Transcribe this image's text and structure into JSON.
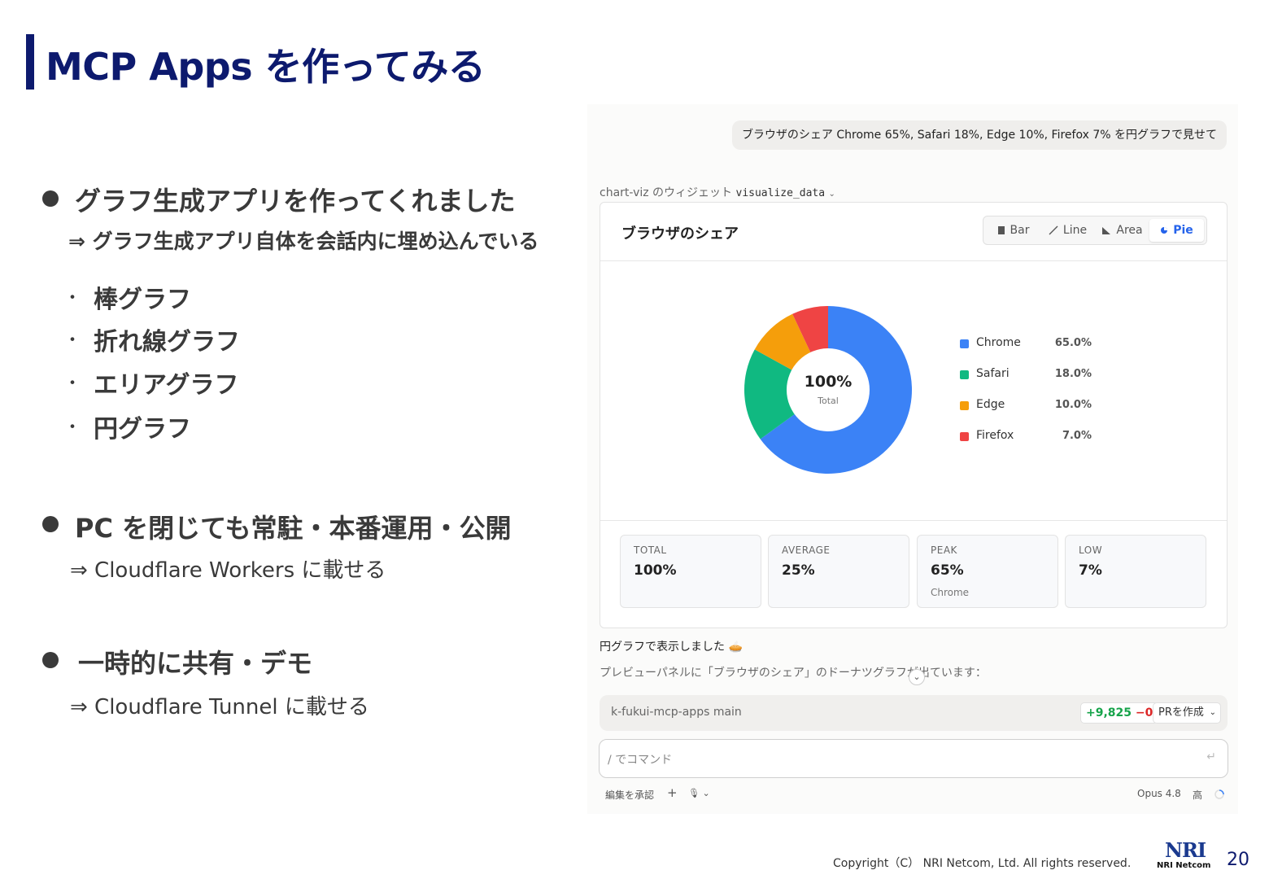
{
  "slide": {
    "title": "MCP Apps を作ってみる",
    "bullets": [
      {
        "heading": "グラフ生成アプリを作ってくれました",
        "sub": "⇒ グラフ生成アプリ自体を会話内に埋め込んでいる",
        "items": [
          "棒グラフ",
          "折れ線グラフ",
          "エリアグラフ",
          "円グラフ"
        ]
      },
      {
        "heading": "PC を閉じても常駐・本番運用・公開",
        "sub": "⇒ Cloudflare Workers に載せる"
      },
      {
        "heading": "一時的に共有・デモ",
        "sub": "⇒ Cloudflare Tunnel に載せる"
      }
    ],
    "list_marker": "・",
    "copyright": "Copyright（C） NRI Netcom, Ltd. All rights reserved.",
    "logo_big": "NRI",
    "logo_small": "NRI Netcom",
    "page_number": "20"
  },
  "chat": {
    "user_message": "ブラウザのシェア Chrome 65%, Safari 18%, Edge 10%, Firefox 7% を円グラフで見せて",
    "widget_prefix": "chart-viz のウィジェット",
    "widget_tool": "visualize_data",
    "widget_chevron": "⌄",
    "card_title": "ブラウザのシェア",
    "chart_types": [
      {
        "icon": "bar-icon",
        "label": "Bar"
      },
      {
        "icon": "line-icon",
        "label": "Line"
      },
      {
        "icon": "area-icon",
        "label": "Area"
      },
      {
        "icon": "pie-icon",
        "label": "Pie"
      }
    ],
    "active_chart_type": "Pie",
    "center_value": "100%",
    "center_label": "Total",
    "stats": [
      {
        "key": "TOTAL",
        "value": "100%",
        "sub": ""
      },
      {
        "key": "AVERAGE",
        "value": "25%",
        "sub": ""
      },
      {
        "key": "PEAK",
        "value": "65%",
        "sub": "Chrome"
      },
      {
        "key": "LOW",
        "value": "7%",
        "sub": ""
      }
    ],
    "reply_line1": "円グラフで表示しました 🥧",
    "reply_line2": "プレビューパネルに「ブラウザのシェア」のドーナツグラフが出ています：",
    "scroll_icon": "⌄",
    "branch": "k-fukui-mcp-apps  main",
    "diff_plus": "+9,825",
    "diff_minus": "−0",
    "pr_button": "PRを作成",
    "pr_chevron": "⌄",
    "command_placeholder": "/ でコマンド",
    "enter_icon": "↵",
    "footer_left": "編集を承認",
    "footer_plus": "+",
    "footer_mic": "🎙 ⌄",
    "model": "Opus 4.8",
    "effort": "高"
  },
  "chart_data": {
    "type": "pie",
    "title": "ブラウザのシェア",
    "categories": [
      "Chrome",
      "Safari",
      "Edge",
      "Firefox"
    ],
    "values": [
      65,
      18,
      10,
      7
    ],
    "labels": [
      "65.0%",
      "18.0%",
      "10.0%",
      "7.0%"
    ],
    "colors": [
      "#3b82f6",
      "#10b981",
      "#f59e0b",
      "#ef4444"
    ],
    "legend": "right",
    "donut": true
  }
}
